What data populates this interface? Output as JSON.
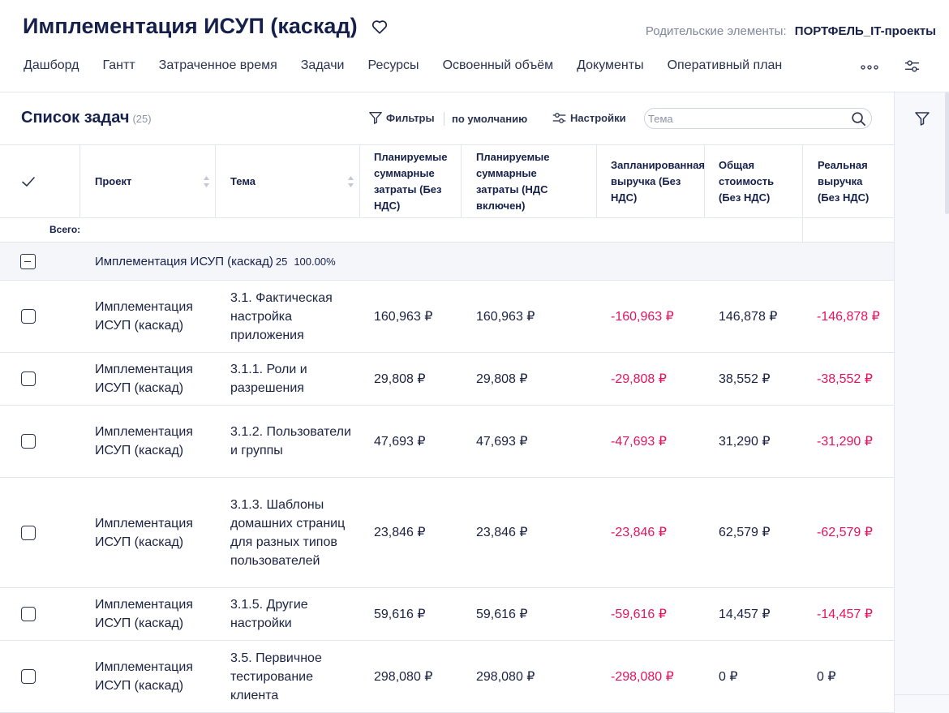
{
  "header": {
    "title": "Имплементация ИСУП (каскад)",
    "parent_label": "Родительские элементы:",
    "parent_value": "ПОРТФЕЛЬ_IT-проекты",
    "tabs": [
      "Дашборд",
      "Гантт",
      "Затраченное время",
      "Задачи",
      "Ресурсы",
      "Освоенный объём",
      "Документы",
      "Оперативный план"
    ]
  },
  "toolbar": {
    "list_title": "Список задач",
    "list_count": "(25)",
    "filters_label": "Фильтры",
    "preset_label": "по умолчанию",
    "settings_label": "Настройки",
    "search_placeholder": "Тема"
  },
  "table": {
    "columns": {
      "project": "Проект",
      "topic": "Тема",
      "plan_cost_novat": "Планируемые суммарные затраты (Без НДС)",
      "plan_cost_vat": "Планируемые суммарные затраты (НДС включен)",
      "plan_revenue": "Запланированная выручка (Без НДС)",
      "total_cost": "Общая стоимость (Без НДС)",
      "real_revenue": "Реальная выручка (Без НДС)"
    },
    "total_label": "Всего:",
    "group": {
      "name": "Имплементация ИСУП (каскад)",
      "count": "25",
      "percent": "100.00%"
    },
    "rows": [
      {
        "project": "Имплементация ИСУП (каскад)",
        "topic": "3.1. Фактическая настройка приложения",
        "plan_cost_novat": "160,963 ₽",
        "plan_cost_vat": "160,963 ₽",
        "plan_revenue": "-160,963 ₽",
        "total_cost": "146,878 ₽",
        "real_revenue": "-146,878 ₽"
      },
      {
        "project": "Имплементация ИСУП (каскад)",
        "topic": "3.1.1. Роли и разрешения",
        "plan_cost_novat": "29,808 ₽",
        "plan_cost_vat": "29,808 ₽",
        "plan_revenue": "-29,808 ₽",
        "total_cost": "38,552 ₽",
        "real_revenue": "-38,552 ₽"
      },
      {
        "project": "Имплементация ИСУП (каскад)",
        "topic": "3.1.2. Пользователи и группы",
        "plan_cost_novat": "47,693 ₽",
        "plan_cost_vat": "47,693 ₽",
        "plan_revenue": "-47,693 ₽",
        "total_cost": "31,290 ₽",
        "real_revenue": "-31,290 ₽"
      },
      {
        "project": "Имплементация ИСУП (каскад)",
        "topic": "3.1.3. Шаблоны домашних страниц для разных типов пользователей",
        "plan_cost_novat": "23,846 ₽",
        "plan_cost_vat": "23,846 ₽",
        "plan_revenue": "-23,846 ₽",
        "total_cost": "62,579 ₽",
        "real_revenue": "-62,579 ₽"
      },
      {
        "project": "Имплементация ИСУП (каскад)",
        "topic": "3.1.5. Другие настройки",
        "plan_cost_novat": "59,616 ₽",
        "plan_cost_vat": "59,616 ₽",
        "plan_revenue": "-59,616 ₽",
        "total_cost": "14,457 ₽",
        "real_revenue": "-14,457 ₽"
      },
      {
        "project": "Имплементация ИСУП (каскад)",
        "topic": "3.5. Первичное тестирование клиента",
        "plan_cost_novat": "298,080 ₽",
        "plan_cost_vat": "298,080 ₽",
        "plan_revenue": "-298,080 ₽",
        "total_cost": "0 ₽",
        "real_revenue": "0 ₽"
      }
    ]
  },
  "colors": {
    "accent_dark": "#16204a",
    "negative": "#e5135e",
    "group_bg": "#f4f6fa",
    "border": "#e3e6ef"
  },
  "icons": {
    "favorite": "heart-icon",
    "more": "more-dots-icon",
    "view_settings": "sliders-icon",
    "filter": "filter-icon",
    "search": "search-icon",
    "check": "check-icon",
    "sort": "sort-icon"
  }
}
